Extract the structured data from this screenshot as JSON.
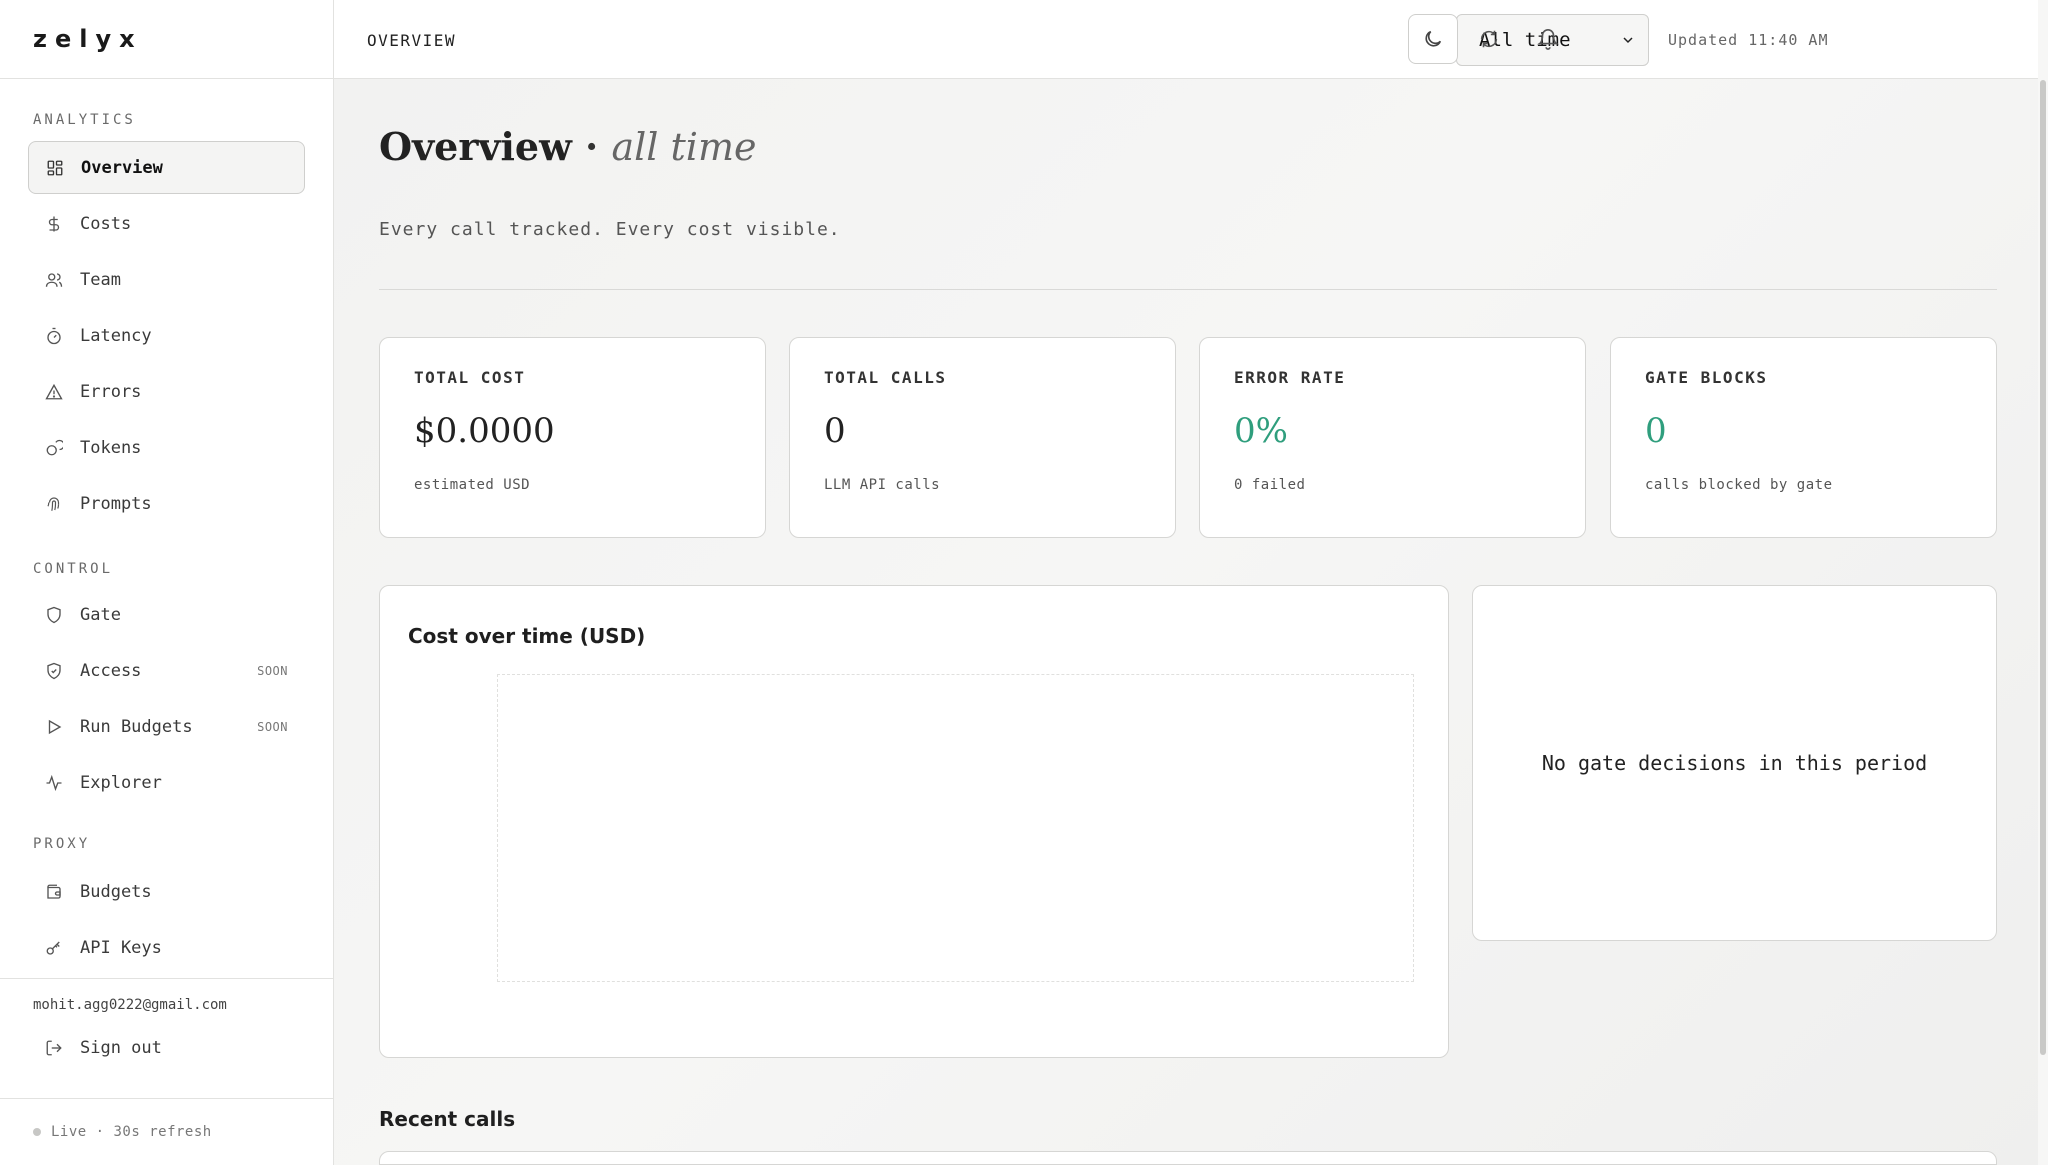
{
  "app": {
    "brand": "zelyx"
  },
  "sidebar": {
    "sections": [
      {
        "label": "ANALYTICS"
      },
      {
        "label": "CONTROL"
      },
      {
        "label": "PROXY"
      }
    ],
    "analytics": [
      {
        "label": "Overview",
        "icon": "grid-icon",
        "active": true
      },
      {
        "label": "Costs",
        "icon": "dollar-icon"
      },
      {
        "label": "Team",
        "icon": "users-icon"
      },
      {
        "label": "Latency",
        "icon": "timer-icon"
      },
      {
        "label": "Errors",
        "icon": "warning-icon"
      },
      {
        "label": "Tokens",
        "icon": "coins-icon"
      },
      {
        "label": "Prompts",
        "icon": "fingerprint-icon"
      }
    ],
    "control": [
      {
        "label": "Gate",
        "icon": "shield-icon"
      },
      {
        "label": "Access",
        "icon": "shield-check-icon",
        "badge": "SOON"
      },
      {
        "label": "Run Budgets",
        "icon": "play-icon",
        "badge": "SOON"
      },
      {
        "label": "Explorer",
        "icon": "activity-icon"
      }
    ],
    "proxy": [
      {
        "label": "Budgets",
        "icon": "wallet-icon"
      },
      {
        "label": "API Keys",
        "icon": "key-icon"
      }
    ],
    "email": "mohit.agg0222@gmail.com",
    "signout": "Sign out",
    "live": "Live · 30s refresh"
  },
  "topbar": {
    "title": "OVERVIEW",
    "range": "All time",
    "updated": "Updated 11:40 AM"
  },
  "main": {
    "heading": "Overview",
    "heading_sep": "·",
    "heading_range": "all time",
    "subtitle": "Every call tracked. Every cost visible.",
    "stats": [
      {
        "label": "TOTAL COST",
        "value": "$0.0000",
        "note": "estimated USD"
      },
      {
        "label": "TOTAL CALLS",
        "value": "0",
        "note": "LLM API calls"
      },
      {
        "label": "ERROR RATE",
        "value": "0%",
        "note": "0 failed"
      },
      {
        "label": "GATE BLOCKS",
        "value": "0",
        "note": "calls blocked by gate"
      }
    ],
    "chart_title": "Cost over time (USD)",
    "gate_empty": "No gate decisions in this period",
    "recent_title": "Recent calls"
  },
  "colors": {
    "accent_green": "#2f9e7d"
  }
}
